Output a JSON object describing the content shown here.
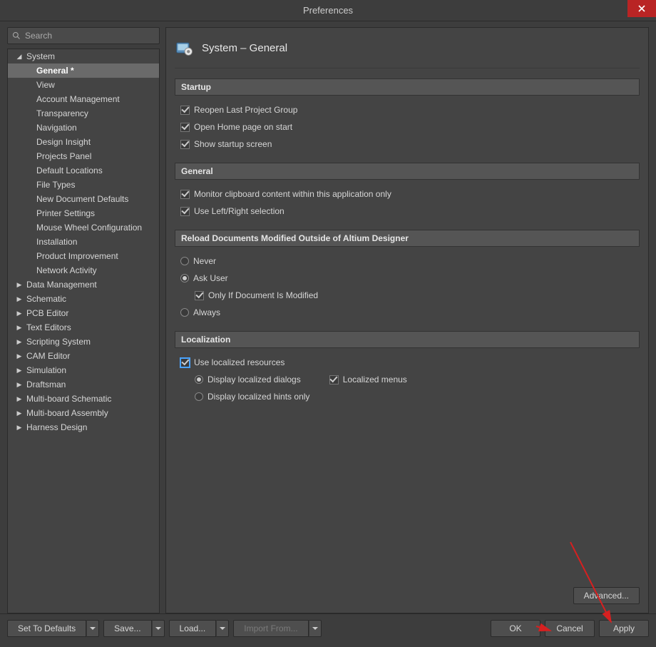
{
  "window": {
    "title": "Preferences"
  },
  "search": {
    "placeholder": "Search"
  },
  "tree": [
    {
      "label": "System",
      "level": 0,
      "expanded": true
    },
    {
      "label": "General *",
      "level": 1,
      "selected": true
    },
    {
      "label": "View",
      "level": 1
    },
    {
      "label": "Account Management",
      "level": 1
    },
    {
      "label": "Transparency",
      "level": 1
    },
    {
      "label": "Navigation",
      "level": 1
    },
    {
      "label": "Design Insight",
      "level": 1
    },
    {
      "label": "Projects Panel",
      "level": 1
    },
    {
      "label": "Default Locations",
      "level": 1
    },
    {
      "label": "File Types",
      "level": 1
    },
    {
      "label": "New Document Defaults",
      "level": 1
    },
    {
      "label": "Printer Settings",
      "level": 1
    },
    {
      "label": "Mouse Wheel Configuration",
      "level": 1
    },
    {
      "label": "Installation",
      "level": 1
    },
    {
      "label": "Product Improvement",
      "level": 1
    },
    {
      "label": "Network Activity",
      "level": 1
    },
    {
      "label": "Data Management",
      "level": 0,
      "expanded": false
    },
    {
      "label": "Schematic",
      "level": 0,
      "expanded": false
    },
    {
      "label": "PCB Editor",
      "level": 0,
      "expanded": false
    },
    {
      "label": "Text Editors",
      "level": 0,
      "expanded": false
    },
    {
      "label": "Scripting System",
      "level": 0,
      "expanded": false
    },
    {
      "label": "CAM Editor",
      "level": 0,
      "expanded": false
    },
    {
      "label": "Simulation",
      "level": 0,
      "expanded": false
    },
    {
      "label": "Draftsman",
      "level": 0,
      "expanded": false
    },
    {
      "label": "Multi-board Schematic",
      "level": 0,
      "expanded": false
    },
    {
      "label": "Multi-board Assembly",
      "level": 0,
      "expanded": false
    },
    {
      "label": "Harness Design",
      "level": 0,
      "expanded": false
    }
  ],
  "page": {
    "title": "System – General"
  },
  "sections": {
    "startup": {
      "title": "Startup",
      "items": [
        {
          "label": "Reopen Last Project Group",
          "checked": true
        },
        {
          "label": "Open Home page on start",
          "checked": true
        },
        {
          "label": "Show startup screen",
          "checked": true
        }
      ]
    },
    "general": {
      "title": "General",
      "items": [
        {
          "label": "Monitor clipboard content within this application only",
          "checked": true
        },
        {
          "label": "Use Left/Right selection",
          "checked": true
        }
      ]
    },
    "reload": {
      "title": "Reload Documents Modified Outside of Altium Designer",
      "options": {
        "never": "Never",
        "ask": "Ask User",
        "only_if": "Only If Document Is Modified",
        "always": "Always"
      },
      "selected": "ask",
      "only_if_checked": true
    },
    "localization": {
      "title": "Localization",
      "use_localized": {
        "label": "Use localized resources",
        "checked": true
      },
      "display_dialogs": {
        "label": "Display localized dialogs",
        "checked": true
      },
      "localized_menus": {
        "label": "Localized menus",
        "checked": true
      },
      "display_hints": {
        "label": "Display localized hints only",
        "checked": false
      }
    }
  },
  "advanced_btn": "Advanced...",
  "footer": {
    "set_defaults": "Set To Defaults",
    "save": "Save...",
    "load": "Load...",
    "import_from": "Import From...",
    "ok": "OK",
    "cancel": "Cancel",
    "apply": "Apply"
  }
}
